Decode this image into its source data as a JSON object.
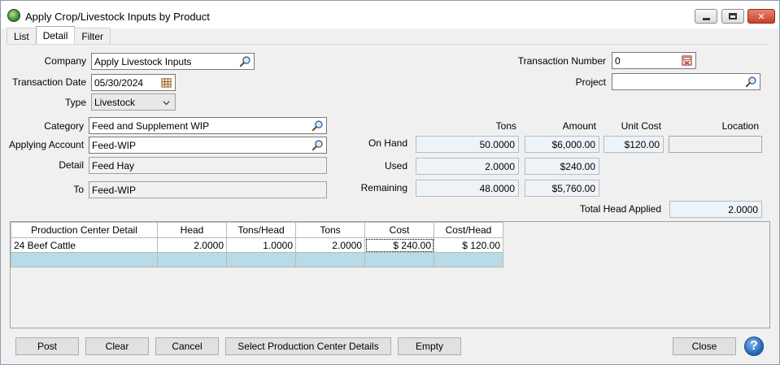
{
  "window": {
    "title": "Apply Crop/Livestock Inputs by Product"
  },
  "tabs": [
    {
      "label": "List"
    },
    {
      "label": "Detail"
    },
    {
      "label": "Filter"
    }
  ],
  "form": {
    "company_label": "Company",
    "company_value": "Apply Livestock Inputs",
    "transaction_date_label": "Transaction Date",
    "transaction_date_value": "05/30/2024",
    "type_label": "Type",
    "type_value": "Livestock",
    "category_label": "Category",
    "category_value": "Feed and Supplement WIP",
    "applying_account_label": "Applying Account",
    "applying_account_value": "Feed-WIP",
    "detail_label": "Detail",
    "detail_value": "Feed Hay",
    "to_label": "To",
    "to_value": "Feed-WIP",
    "transaction_number_label": "Transaction Number",
    "transaction_number_value": "0",
    "project_label": "Project",
    "project_value": ""
  },
  "summary": {
    "col_tons": "Tons",
    "col_amount": "Amount",
    "col_unit_cost": "Unit Cost",
    "col_location": "Location",
    "on_hand_label": "On Hand",
    "on_hand_tons": "50.0000",
    "on_hand_amount": "$6,000.00",
    "unit_cost": "$120.00",
    "location": "",
    "used_label": "Used",
    "used_tons": "2.0000",
    "used_amount": "$240.00",
    "remaining_label": "Remaining",
    "remaining_tons": "48.0000",
    "remaining_amount": "$5,760.00",
    "total_head_applied_label": "Total Head Applied",
    "total_head_applied": "2.0000"
  },
  "grid": {
    "headers": [
      "Production Center Detail",
      "Head",
      "Tons/Head",
      "Tons",
      "Cost",
      "Cost/Head"
    ],
    "rows": [
      [
        "24 Beef Cattle",
        "2.0000",
        "1.0000",
        "2.0000",
        "$ 240.00",
        "$ 120.00"
      ]
    ]
  },
  "buttons": {
    "post": "Post",
    "clear": "Clear",
    "cancel": "Cancel",
    "select_pcd": "Select Production Center Details",
    "empty": "Empty",
    "close": "Close",
    "help": "?"
  },
  "icons": {
    "lookup": "magnifier-icon",
    "calendar": "calendar-icon",
    "dropdown": "chevron-down-icon"
  }
}
